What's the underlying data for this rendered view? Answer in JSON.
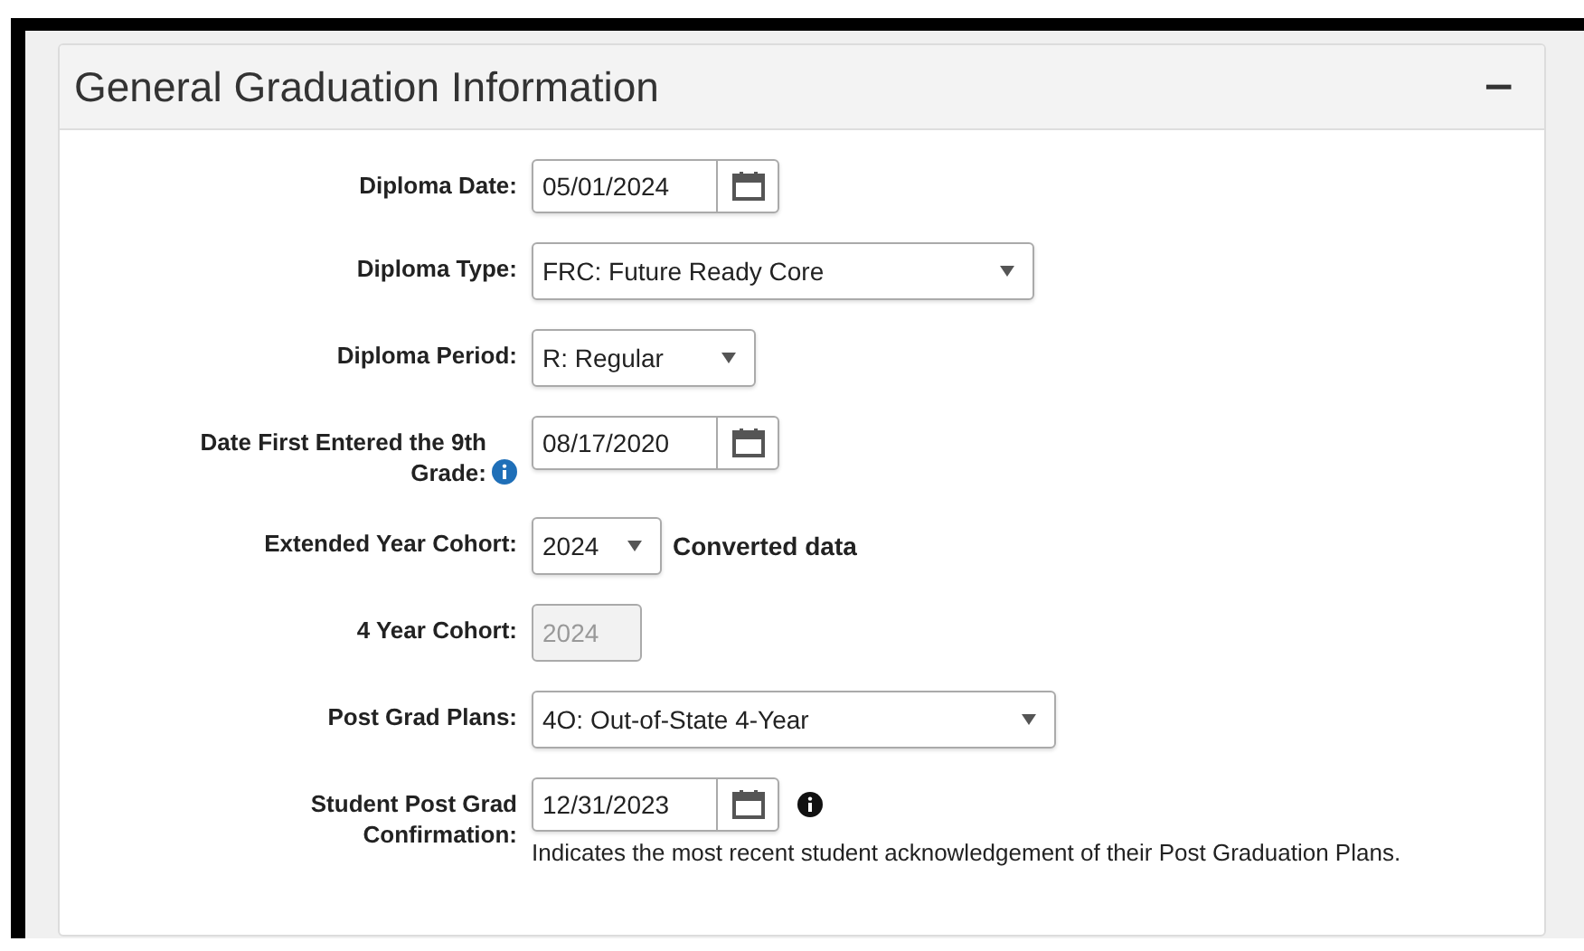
{
  "panel": {
    "title": "General Graduation Information",
    "collapse_button": "−"
  },
  "fields": [
    {
      "label": "Diploma Date:",
      "kind": "date",
      "value": "05/01/2024"
    },
    {
      "label": "Diploma Type:",
      "kind": "select",
      "value": "FRC: Future Ready Core"
    },
    {
      "label": "Diploma Period:",
      "kind": "select",
      "value": "R: Regular"
    },
    {
      "label": "Date First Entered the 9th Grade:",
      "kind": "date",
      "value": "08/17/2020",
      "label_info": true
    },
    {
      "label": "Extended Year Cohort:",
      "kind": "select",
      "value": "2024",
      "note": "Converted data"
    },
    {
      "label": "4 Year Cohort:",
      "kind": "text",
      "value": "2024",
      "disabled": true
    },
    {
      "label": "Post Grad Plans:",
      "kind": "select",
      "value": "4O: Out-of-State 4-Year"
    },
    {
      "label": "Student Post Grad Confirmation:",
      "kind": "date",
      "value": "12/31/2023",
      "field_info": true,
      "help": "Indicates the most recent student acknowledgement of their Post Graduation Plans."
    }
  ]
}
